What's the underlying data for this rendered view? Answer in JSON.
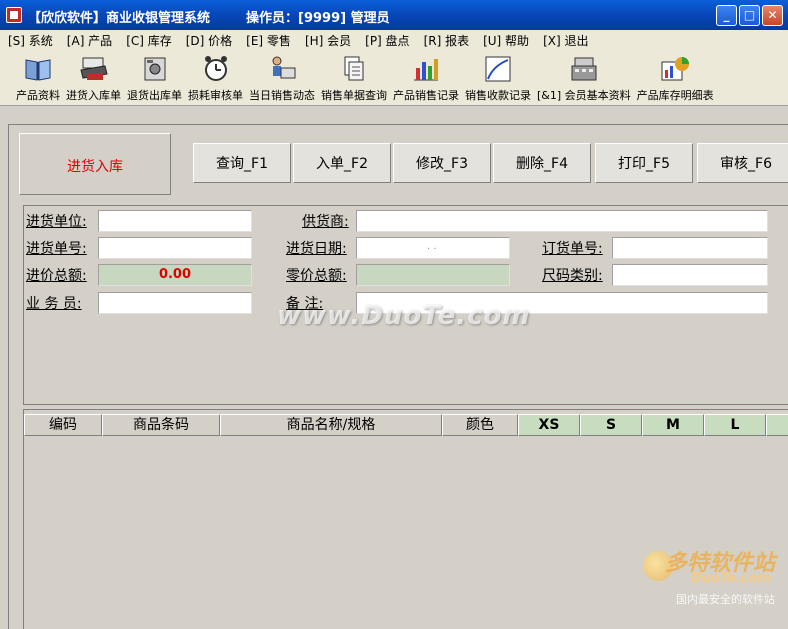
{
  "window": {
    "title": "【欣欣软件】商业收银管理系统",
    "operator": "操作员：[9999] 管理员",
    "minimize_glyph": "_",
    "maximize_glyph": "□",
    "close_glyph": "✕"
  },
  "menu": [
    "[S] 系统",
    "[A] 产品",
    "[C] 库存",
    "[D] 价格",
    "[E] 零售",
    "[H] 会员",
    "[P] 盘点",
    "[R] 报表",
    "[U] 帮助",
    "[X] 退出"
  ],
  "toolbar": [
    {
      "label": "产品资料",
      "icon": "book-icon"
    },
    {
      "label": "进货入库单",
      "icon": "truck-inbound-icon"
    },
    {
      "label": "退货出库单",
      "icon": "safe-icon"
    },
    {
      "label": "损耗审核单",
      "icon": "alarm-clock-icon"
    },
    {
      "label": "当日销售动态",
      "icon": "person-computer-icon"
    },
    {
      "label": "销售单据查询",
      "icon": "documents-icon"
    },
    {
      "label": "产品销售记录",
      "icon": "bar-chart-icon"
    },
    {
      "label": "销售收款记录",
      "icon": "line-chart-icon"
    },
    {
      "label": "[&1] 会员基本资料",
      "icon": "cash-register-icon"
    },
    {
      "label": "产品库存明细表",
      "icon": "pie-chart-icon"
    }
  ],
  "page_title": "进货入库",
  "actions": [
    "查询_F1",
    "入单_F2",
    "修改_F3",
    "删除_F4",
    "打印_F5",
    "审核_F6"
  ],
  "form": {
    "inbound_unit_label": "进货单位:",
    "order_no_label": "进货单号:",
    "total_cost_label": "进价总额:",
    "total_cost_value": "0.00",
    "salesperson_label": "业 务 员:",
    "supplier_label": "供货商:",
    "date_label": "进货日期:",
    "date_placeholder": ". .",
    "retail_total_label": "零价总额:",
    "remark_label": "备    注:",
    "purchase_order_label": "订货单号:",
    "size_type_label": "尺码类别:"
  },
  "watermark": "www.DuoTe.com",
  "grid_columns": [
    "编码",
    "商品条码",
    "商品名称/规格",
    "颜色",
    "XS",
    "S",
    "M",
    "L"
  ],
  "logo": {
    "line1": "多特软件站",
    "line2": "DuoTe.com",
    "line3": "国内最安全的软件站"
  }
}
